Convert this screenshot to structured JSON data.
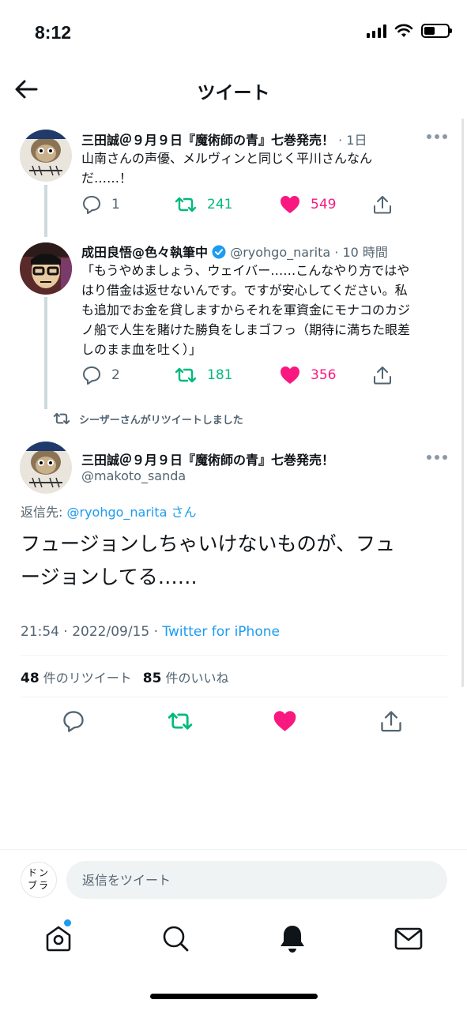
{
  "status": {
    "time": "8:12"
  },
  "header": {
    "title": "ツイート"
  },
  "thread": [
    {
      "name": "三田誠＠９月９日『魔術師の青』七巻発売！",
      "meta": "· 1日",
      "text_lines": [
        "山南さんの声優、メルヴィンと同じく平川さんなん",
        "だ……！"
      ],
      "replies": "1",
      "retweets": "241",
      "likes": "549"
    },
    {
      "name": "成田良悟@色々執筆中",
      "handle": "@ryohgo_narita",
      "meta": "· 10 時間",
      "text_lines": [
        "「もうやめましょう、ウェイバー……こんなやり方ではや",
        "はり借金は返せないんです。ですが安心してください。私",
        "も追加でお金を貸しますからそれを軍資金にモナコのカジ",
        "ノ船で人生を賭けた勝負をしまゴフっ（期待に満ちた眼差",
        "しのまま血を吐く）」"
      ],
      "replies": "2",
      "retweets": "181",
      "likes": "356"
    }
  ],
  "retweet_banner": "シーザーさんがリツイートしました",
  "main_tweet": {
    "name": "三田誠＠９月９日『魔術師の青』七巻発売！",
    "handle": "@makoto_sanda",
    "reply_prefix": "返信先: ",
    "reply_handle": "@ryohgo_narita",
    "reply_suffix": " さん",
    "text_lines": [
      "フュージョンしちゃいけないものが、フュ",
      "ージョンしてる……"
    ],
    "time": "21:54 · 2022/09/15 · ",
    "via": "Twitter for iPhone",
    "retweet_count": "48",
    "retweet_label": "件のリツイート",
    "like_count": "85",
    "like_label": "件のいいね"
  },
  "reply_bar": {
    "avatar_text_1": "ドン",
    "avatar_text_2": "ブラ",
    "placeholder": "返信をツイート"
  },
  "colors": {
    "accent": "#1d9bf0",
    "retweet": "#00ba7c",
    "like": "#f91880",
    "muted": "#536471"
  },
  "icons": [
    "back-arrow-icon",
    "reply-icon",
    "retweet-icon",
    "heart-icon",
    "share-icon",
    "more-icon",
    "home-icon",
    "search-icon",
    "bell-icon",
    "mail-icon",
    "verified-icon"
  ]
}
